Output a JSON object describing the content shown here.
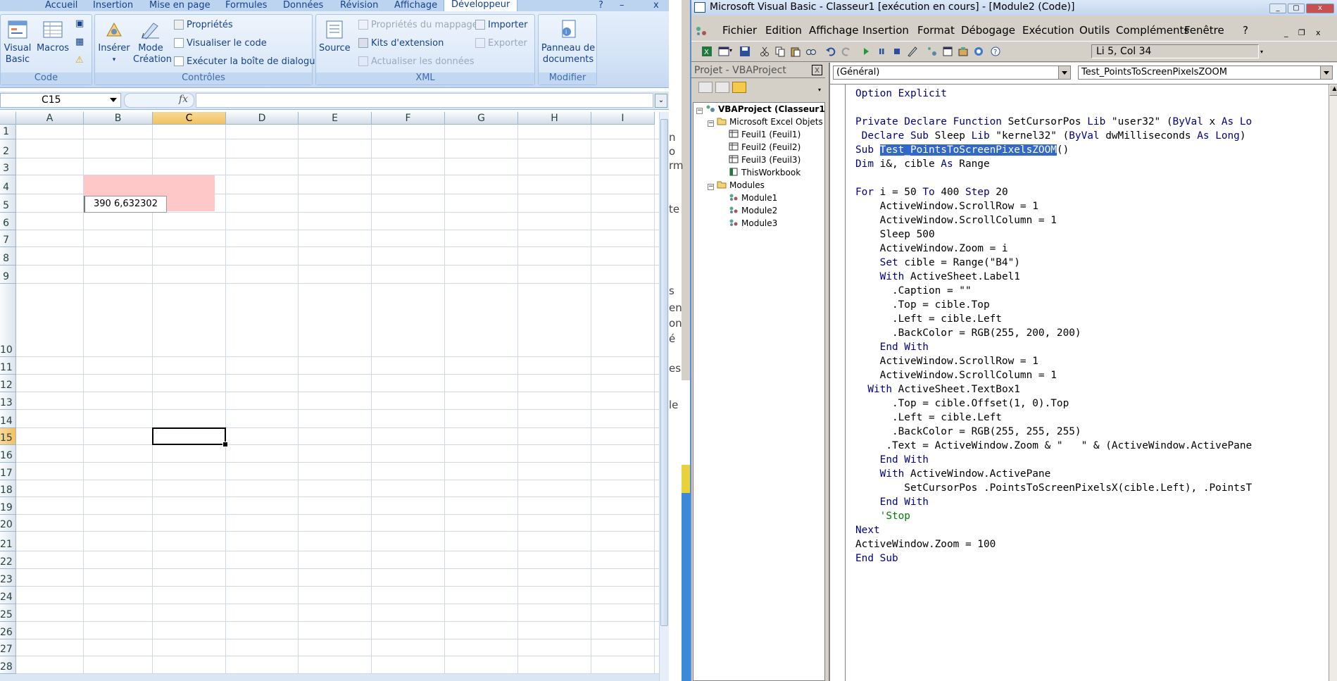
{
  "excel": {
    "tabs": [
      "Accueil",
      "Insertion",
      "Mise en page",
      "Formules",
      "Données",
      "Révision",
      "Affichage",
      "Développeur"
    ],
    "ribbon": {
      "code_group": {
        "caption": "Code",
        "visual_basic": "Visual Basic",
        "macros": "Macros"
      },
      "controls_group": {
        "caption": "Contrôles",
        "inserer": "Insérer",
        "mode_creation": "Mode Création",
        "proprietes": "Propriétés",
        "visualiser_code": "Visualiser le code",
        "executer_boite": "Exécuter la boîte de dialogue"
      },
      "xml_group": {
        "caption": "XML",
        "source": "Source",
        "prop_mappage": "Propriétés du mappage",
        "kits": "Kits d'extension",
        "actualiser": "Actualiser les données",
        "importer": "Importer",
        "exporter": "Exporter"
      },
      "modifier_group": {
        "caption": "Modifier",
        "panneau": "Panneau de documents"
      }
    },
    "name_box": "C15",
    "fx_symbol": "fx",
    "columns": [
      "A",
      "B",
      "C",
      "D",
      "E",
      "F",
      "G",
      "H",
      "I"
    ],
    "selected_column": "C",
    "rows": [
      "1",
      "2",
      "3",
      "4",
      "5",
      "6",
      "7",
      "8",
      "9",
      "10",
      "11",
      "12",
      "13",
      "14",
      "15",
      "16",
      "17",
      "18",
      "19",
      "20",
      "21",
      "22",
      "23",
      "24",
      "25",
      "26",
      "27",
      "28"
    ],
    "selected_row": "15",
    "textbox1_text": "390   6,632302",
    "label1_color": "#ffc8c8"
  },
  "mid_strip_chars": [
    "n",
    "o",
    "rm",
    "t c",
    "te",
    "s",
    "en",
    "on",
    "é",
    "es",
    "le"
  ],
  "vbe": {
    "title": "Microsoft Visual Basic - Classeur1 [exécution en cours] - [Module2 (Code)]",
    "menu": [
      "Fichier",
      "Edition",
      "Affichage",
      "Insertion",
      "Format",
      "Débogage",
      "Exécution",
      "Outils",
      "Compléments",
      "Fenêtre",
      "?"
    ],
    "position": "Li 5, Col 34",
    "project_title": "Projet - VBAProject",
    "tree": {
      "root": "VBAProject (Classeur1",
      "excel_objects": "Microsoft Excel Objets",
      "sheets": [
        "Feuil1 (Feuil1)",
        "Feuil2 (Feuil2)",
        "Feuil3 (Feuil3)",
        "ThisWorkbook"
      ],
      "modules_folder": "Modules",
      "modules": [
        "Module1",
        "Module2",
        "Module3"
      ]
    },
    "object_combo": "(Général)",
    "proc_combo": "Test_PointsToScreenPixelsZOOM",
    "code_lines": [
      [
        {
          "t": "Option Explicit",
          "c": "kw"
        }
      ],
      [
        {
          "t": "",
          "c": ""
        }
      ],
      [
        {
          "t": "Private Declare Function ",
          "c": "kw"
        },
        {
          "t": "SetCursorPos ",
          "c": ""
        },
        {
          "t": "Lib ",
          "c": "kw"
        },
        {
          "t": "\"user32\" (",
          "c": ""
        },
        {
          "t": "ByVal ",
          "c": "kw"
        },
        {
          "t": "x ",
          "c": ""
        },
        {
          "t": "As Lo",
          "c": "kw"
        }
      ],
      [
        {
          "t": " Declare Sub ",
          "c": "kw"
        },
        {
          "t": "Sleep ",
          "c": ""
        },
        {
          "t": "Lib ",
          "c": "kw"
        },
        {
          "t": "\"kernel32\" (",
          "c": ""
        },
        {
          "t": "ByVal ",
          "c": "kw"
        },
        {
          "t": "dwMilliseconds ",
          "c": ""
        },
        {
          "t": "As Long",
          "c": "kw"
        },
        {
          "t": ")",
          "c": ""
        }
      ],
      [
        {
          "t": "Sub ",
          "c": "kw"
        },
        {
          "t": "Test_PointsToScreenPixelsZOOM",
          "c": "hl"
        },
        {
          "t": "()",
          "c": ""
        }
      ],
      [
        {
          "t": "Dim ",
          "c": "kw"
        },
        {
          "t": "i&, cible ",
          "c": ""
        },
        {
          "t": "As ",
          "c": "kw"
        },
        {
          "t": "Range",
          "c": ""
        }
      ],
      [
        {
          "t": "",
          "c": ""
        }
      ],
      [
        {
          "t": "For ",
          "c": "kw"
        },
        {
          "t": "i = 50 ",
          "c": ""
        },
        {
          "t": "To ",
          "c": "kw"
        },
        {
          "t": "400 ",
          "c": ""
        },
        {
          "t": "Step ",
          "c": "kw"
        },
        {
          "t": "20",
          "c": ""
        }
      ],
      [
        {
          "t": "    ActiveWindow.ScrollRow = 1",
          "c": ""
        }
      ],
      [
        {
          "t": "    ActiveWindow.ScrollColumn = 1",
          "c": ""
        }
      ],
      [
        {
          "t": "    Sleep 500",
          "c": ""
        }
      ],
      [
        {
          "t": "    ActiveWindow.Zoom = i",
          "c": ""
        }
      ],
      [
        {
          "t": "    ",
          "c": ""
        },
        {
          "t": "Set ",
          "c": "kw"
        },
        {
          "t": "cible = Range(\"B4\")",
          "c": ""
        }
      ],
      [
        {
          "t": "    ",
          "c": ""
        },
        {
          "t": "With ",
          "c": "kw"
        },
        {
          "t": "ActiveSheet.Label1",
          "c": ""
        }
      ],
      [
        {
          "t": "      .Caption = \"\"",
          "c": ""
        }
      ],
      [
        {
          "t": "      .Top = cible.Top",
          "c": ""
        }
      ],
      [
        {
          "t": "      .Left = cible.Left",
          "c": ""
        }
      ],
      [
        {
          "t": "      .BackColor = RGB(255, 200, 200)",
          "c": ""
        }
      ],
      [
        {
          "t": "    ",
          "c": ""
        },
        {
          "t": "End With",
          "c": "kw"
        }
      ],
      [
        {
          "t": "    ActiveWindow.ScrollRow = 1",
          "c": ""
        }
      ],
      [
        {
          "t": "    ActiveWindow.ScrollColumn = 1",
          "c": ""
        }
      ],
      [
        {
          "t": "  ",
          "c": ""
        },
        {
          "t": "With ",
          "c": "kw"
        },
        {
          "t": "ActiveSheet.TextBox1",
          "c": ""
        }
      ],
      [
        {
          "t": "      .Top = cible.Offset(1, 0).Top",
          "c": ""
        }
      ],
      [
        {
          "t": "      .Left = cible.Left",
          "c": ""
        }
      ],
      [
        {
          "t": "      .BackColor = RGB(255, 255, 255)",
          "c": ""
        }
      ],
      [
        {
          "t": "     .Text = ActiveWindow.Zoom & \"   \" & (ActiveWindow.ActivePane",
          "c": ""
        }
      ],
      [
        {
          "t": "    ",
          "c": ""
        },
        {
          "t": "End With",
          "c": "kw"
        }
      ],
      [
        {
          "t": "    ",
          "c": ""
        },
        {
          "t": "With ",
          "c": "kw"
        },
        {
          "t": "ActiveWindow.ActivePane",
          "c": ""
        }
      ],
      [
        {
          "t": "        SetCursorPos .PointsToScreenPixelsX(cible.Left), .PointsT",
          "c": ""
        }
      ],
      [
        {
          "t": "    ",
          "c": ""
        },
        {
          "t": "End With",
          "c": "kw"
        }
      ],
      [
        {
          "t": "    'Stop",
          "c": "cm"
        }
      ],
      [
        {
          "t": "Next",
          "c": "kw"
        }
      ],
      [
        {
          "t": "ActiveWindow.Zoom = 100",
          "c": ""
        }
      ],
      [
        {
          "t": "End Sub",
          "c": "kw"
        }
      ]
    ]
  }
}
